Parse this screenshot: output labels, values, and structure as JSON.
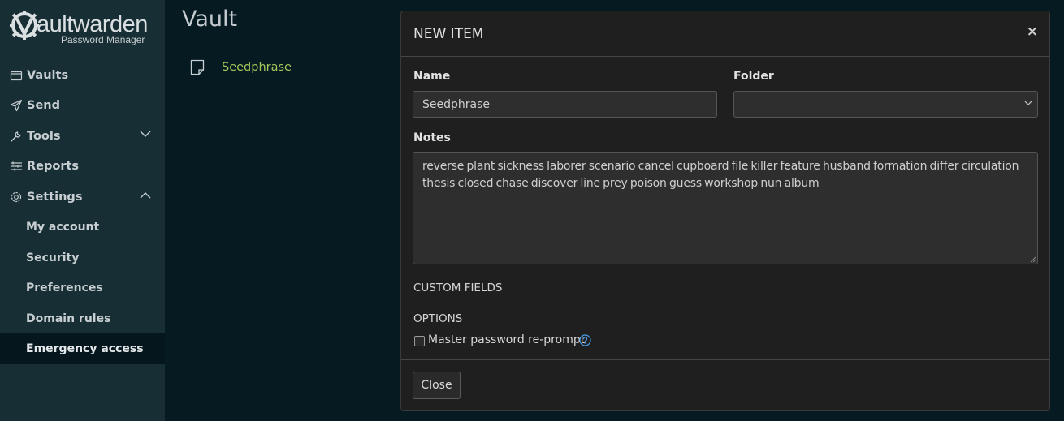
{
  "brand": {
    "name": "Vaultwarden",
    "word_rest": "aultwarden",
    "subtitle": "Password Manager"
  },
  "sidebar": {
    "items": [
      {
        "label": "Vaults",
        "icon": "vault-icon"
      },
      {
        "label": "Send",
        "icon": "send-icon"
      },
      {
        "label": "Tools",
        "icon": "wrench-icon",
        "expandable": true,
        "expanded": false
      },
      {
        "label": "Reports",
        "icon": "sliders-icon"
      },
      {
        "label": "Settings",
        "icon": "gear-icon",
        "expandable": true,
        "expanded": true
      }
    ],
    "settings_sub": [
      {
        "label": "My account"
      },
      {
        "label": "Security"
      },
      {
        "label": "Preferences"
      },
      {
        "label": "Domain rules"
      },
      {
        "label": "Emergency access",
        "active": true
      }
    ]
  },
  "vault": {
    "title": "Vault",
    "entries": [
      {
        "label": "Seedphrase",
        "icon": "note-icon"
      }
    ]
  },
  "modal": {
    "title": "NEW ITEM",
    "close_glyph": "×",
    "name_label": "Name",
    "name_value": "Seedphrase",
    "folder_label": "Folder",
    "folder_value": "",
    "notes_label": "Notes",
    "notes_value": "reverse plant sickness laborer scenario cancel cupboard file killer feature husband formation differ circulation thesis closed chase discover line prey poison guess workshop nun album",
    "custom_fields_label": "CUSTOM FIELDS",
    "options_label": "OPTIONS",
    "reprompt_label": "Master password re-prompt",
    "reprompt_checked": false,
    "close_button": "Close"
  },
  "colors": {
    "sidebar_bg": "#182e35",
    "page_bg": "#061a21",
    "accent_green": "#a7c75a",
    "modal_bg": "#1f1f1f",
    "help_blue": "#4a9fe8"
  }
}
